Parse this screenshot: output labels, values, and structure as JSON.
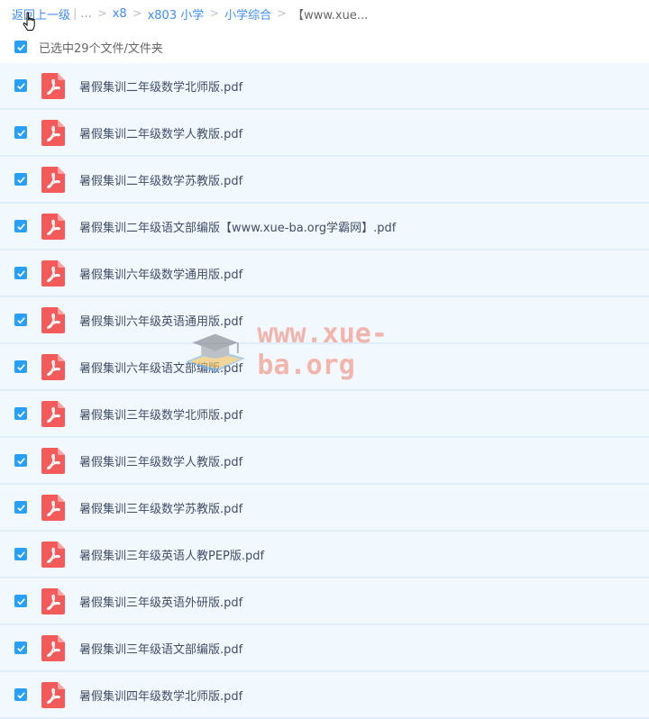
{
  "breadcrumb": {
    "back_label": "返回上一级",
    "ellipsis": "...",
    "items": [
      "x8",
      "x803 小学",
      "小学综合"
    ],
    "current": "【www.xue..."
  },
  "selection": {
    "summary": "已选中29个文件/文件夹",
    "checked": true
  },
  "files": [
    {
      "name": "暑假集训二年级数学北师版.pdf",
      "checked": true
    },
    {
      "name": "暑假集训二年级数学人教版.pdf",
      "checked": true
    },
    {
      "name": "暑假集训二年级数学苏教版.pdf",
      "checked": true
    },
    {
      "name": "暑假集训二年级语文部编版【www.xue-ba.org学霸网】.pdf",
      "checked": true
    },
    {
      "name": "暑假集训六年级数学通用版.pdf",
      "checked": true
    },
    {
      "name": "暑假集训六年级英语通用版.pdf",
      "checked": true
    },
    {
      "name": "暑假集训六年级语文部编版.pdf",
      "checked": true
    },
    {
      "name": "暑假集训三年级数学北师版.pdf",
      "checked": true
    },
    {
      "name": "暑假集训三年级数学人教版.pdf",
      "checked": true
    },
    {
      "name": "暑假集训三年级数学苏教版.pdf",
      "checked": true
    },
    {
      "name": "暑假集训三年级英语人教PEP版.pdf",
      "checked": true
    },
    {
      "name": "暑假集训三年级英语外研版.pdf",
      "checked": true
    },
    {
      "name": "暑假集训三年级语文部编版.pdf",
      "checked": true
    },
    {
      "name": "暑假集训四年级数学北师版.pdf",
      "checked": true
    }
  ],
  "watermark": {
    "text": "www.xue-ba.org"
  },
  "colors": {
    "accent": "#2a9ff6",
    "pdf": "#f35b5b",
    "row_bg": "#f1f8fe"
  }
}
